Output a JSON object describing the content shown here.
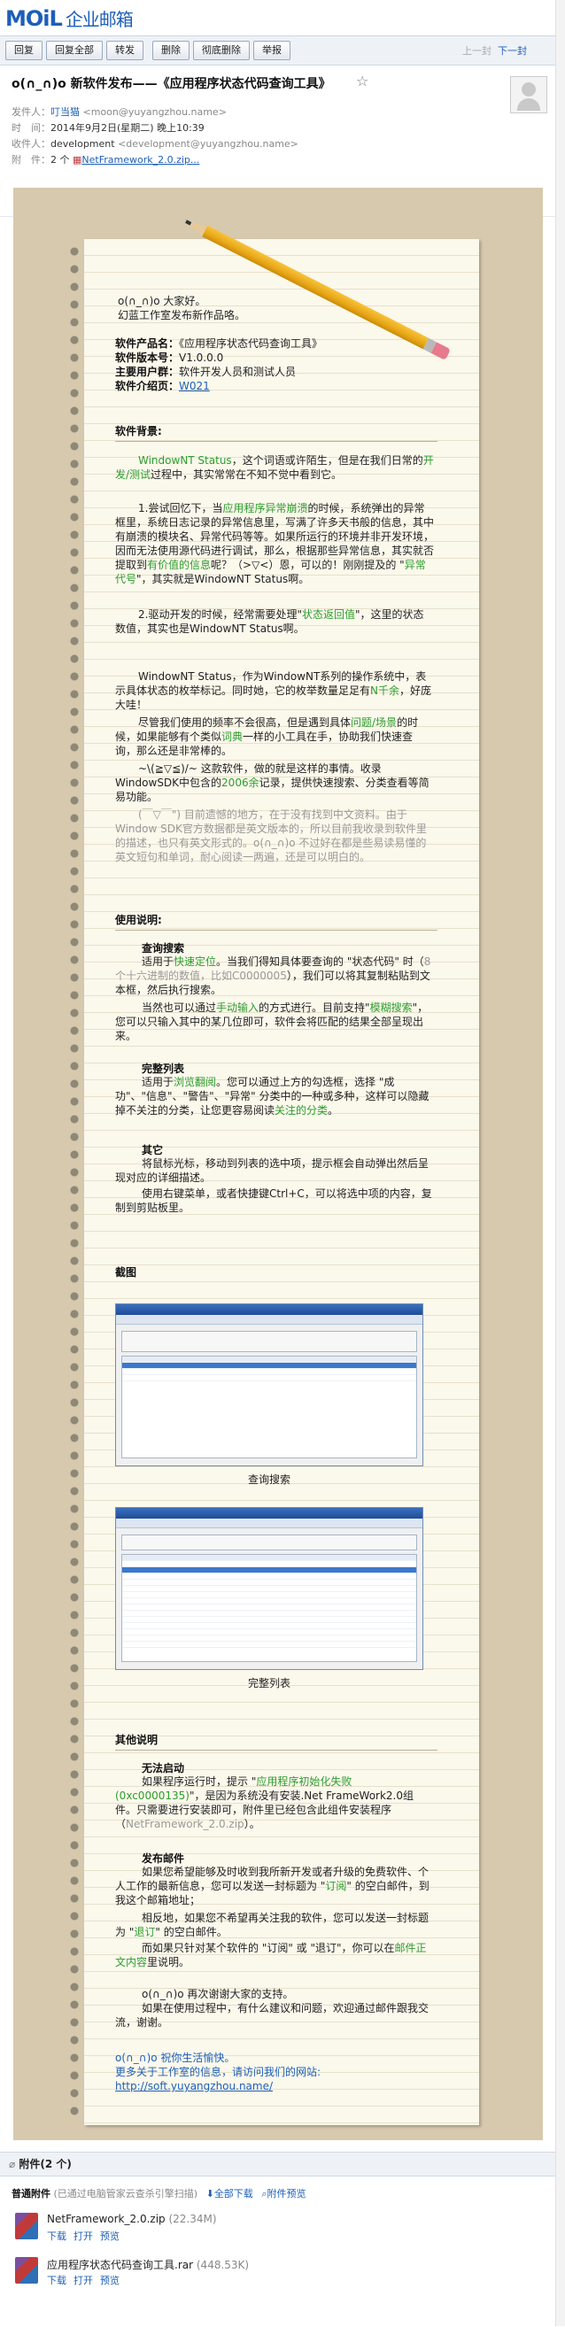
{
  "app": {
    "logo": "MOiL",
    "logo_sub": "企业邮箱"
  },
  "toolbar": {
    "buttons": [
      "回复",
      "回复全部",
      "转发",
      "删除",
      "彻底删除",
      "举报"
    ],
    "prev": "上一封",
    "next": "下一封"
  },
  "mail": {
    "subject": "o(∩_∩)o 新软件发布——《应用程序状态代码查询工具》",
    "from_label": "发件人：",
    "from_name": "叮当猫",
    "from_addr": "<moon@yuyangzhou.name>",
    "time_label": "时　间：",
    "time": "2014年9月2日(星期二) 晚上10:39",
    "to_label": "收件人：",
    "to_name": "development",
    "to_addr": "<development@yuyangzhou.name>",
    "attach_label": "附　件：",
    "attach_count": "2 个",
    "attach_first": "NetFramework_2.0.zip..."
  },
  "letter": {
    "greet1": "o(∩_∩)o  大家好。",
    "greet2": "幻蓝工作室发布新作品咯。",
    "product_label": "软件产品名：",
    "product": "《应用程序状态代码查询工具》",
    "version_label": "软件版本号：",
    "version": "V1.0.0.0",
    "users_label": "主要用户群：",
    "users": "软件开发人员和测试人员",
    "intro_label": "软件介绍页：",
    "intro_link": "W021",
    "bg_title": "软件背景:",
    "bg_p1a": "WindowNT Status",
    "bg_p1b": "，这个词语或许陌生，但是在我们日常的",
    "bg_p1c": "开发/测试",
    "bg_p1d": "过程中，其实常常在不知不觉中看到它。",
    "bg_p2": "1.尝试回忆下，当",
    "bg_p2g": "应用程序异常崩溃",
    "bg_p2b": "的时候，系统弹出的异常框里，系统日志记录的异常信息里，写满了许多天书般的信息，其中有崩溃的模块名、异常代码等等。如果所运行的环境并非开发环境，因而无法使用源代码进行调试，那么，根据那些异常信息，其实就否提取到",
    "bg_p2g2": "有价值的信息",
    "bg_p2c": "呢？（>▽<）恩，可以的！刚刚提及的 \"",
    "bg_p2g3": "异常代号",
    "bg_p2d": "\"，其实就是WindowNT Status啊。",
    "bg_p3": "2.驱动开发的时候，经常需要处理\"",
    "bg_p3g": "状态返回值",
    "bg_p3b": "\"，这里的状态数值，其实也是WindowNT Status啊。",
    "bg_p4": "WindowNT Status，作为WindowNT系列的操作系统中，表示具体状态的枚举标记。同时她，它的枚举数量足足有",
    "bg_p4g": "N千余",
    "bg_p4b": "，好庞大哇！",
    "bg_p5": "尽管我们使用的频率不会很高，但是遇到具体",
    "bg_p5g": "问题/场景",
    "bg_p5b": "的时候，如果能够有个类似",
    "bg_p5g2": "词典",
    "bg_p5c": "一样的小工具在手，协助我们快速查询，那么还是非常棒的。",
    "bg_p6": "~\\(≧▽≦)/~ 这款软件，做的就是这样的事情。收录WindowSDK中包含的",
    "bg_p6g": "2006余",
    "bg_p6b": "记录，提供快速搜索、分类查看等简易功能。",
    "bg_p7": "(￣▽￣\") 目前遗憾的地方，在于没有找到中文资料。由于Window SDK官方数据都是英文版本的，所以目前我收录到软件里的描述，也只有英文形式的。o(∩_∩)o 不过好在都是些易读易懂的英文短句和单词，耐心阅读一两遍，还是可以明白的。",
    "use_title": "使用说明:",
    "search_h": "查询搜索",
    "search_p1a": "适用于",
    "search_p1g": "快速定位",
    "search_p1b": "。当我们得知具体要查询的 \"状态代码\" 时（",
    "search_p1grey": "8个十六进制的数值，比如C0000005",
    "search_p1c": "），我们可以将其复制粘贴到文本框，然后执行搜索。",
    "search_p2a": "当然也可以通过",
    "search_p2g": "手动输入",
    "search_p2b": "的方式进行。目前支持\"",
    "search_p2g2": "模糊搜索",
    "search_p2c": "\"，您可以只输入其中的某几位即可，软件会将匹配的结果全部呈现出来。",
    "list_h": "完整列表",
    "list_p1a": "适用于",
    "list_p1g": "浏览翻阅",
    "list_p1b": "。您可以通过上方的勾选框，选择 \"成功\"、\"信息\"、\"警告\"、\"异常\" 分类中的一种或多种，这样可以隐藏掉不关注的分类，让您更容易阅读",
    "list_p1g2": "关注的分类",
    "list_p1c": "。",
    "other_h": "其它",
    "other_p1": "将鼠标光标，移动到列表的选中项，提示框会自动弹出然后呈现对应的详细描述。",
    "other_p2": "使用右键菜单，或者快捷键Ctrl+C，可以将选中项的内容，复制到剪贴板里。",
    "shot_title": "截图",
    "shot1_caption": "查询搜索",
    "shot2_caption": "完整列表",
    "misc_title": "其他说明",
    "fail_h": "无法启动",
    "fail_p1a": "如果程序运行时，提示 \"",
    "fail_p1g": "应用程序初始化失败 (0xc0000135)",
    "fail_p1b": "\"，是因为系统没有安装.Net FrameWork2.0组件。只需要进行安装即可，附件里已经包含此组件安装程序（",
    "fail_p1grey": "NetFramework_2.0.zip",
    "fail_p1c": "）。",
    "post_h": "发布邮件",
    "post_p1a": "如果您希望能够及时收到我所新开发或者升级的免费软件、个人工作的最新信息，您可以发送一封标题为 \"",
    "post_p1g": "订阅",
    "post_p1b": "\" 的空白邮件，到我这个邮箱地址；",
    "post_p2a": "相反地，如果您不希望再关注我的软件，您可以发送一封标题为 \"",
    "post_p2g": "退订",
    "post_p2b": "\" 的空白邮件。",
    "post_p3a": "而如果只针对某个软件的 \"订阅\" 或 \"退订\"，你可以在",
    "post_p3g": "邮件正文内容",
    "post_p3b": "里说明。",
    "thanks1": "o(∩_∩)o 再次谢谢大家的支持。",
    "thanks2": "如果在使用过程中，有什么建议和问题，欢迎通过邮件跟我交流，谢谢。",
    "sign1": "o(∩_∩)o  祝你生活愉快。",
    "sign2": "更多关于工作室的信息，请访问我们的网站:",
    "sign_url": "http://soft.yuyangzhou.name/"
  },
  "attachments": {
    "header": "附件(2 个)",
    "normal_label": "普通附件",
    "normal_note": "(已通过电脑管家云查杀引擎扫描)",
    "download_all": "全部下载",
    "preview_all": "附件预览",
    "files": [
      {
        "name": "NetFramework_2.0.zip",
        "size": "(22.34M)",
        "actions": [
          "下载",
          "打开",
          "预览"
        ]
      },
      {
        "name": "应用程序状态代码查询工具.rar",
        "size": "(448.53K)",
        "actions": [
          "下载",
          "打开",
          "预览"
        ]
      }
    ]
  },
  "colors": {
    "brand": "#1d5fb8",
    "highlight": "#2e9d2e",
    "letter_bg": "#d7c9ae",
    "paper": "#fbf8ec"
  }
}
